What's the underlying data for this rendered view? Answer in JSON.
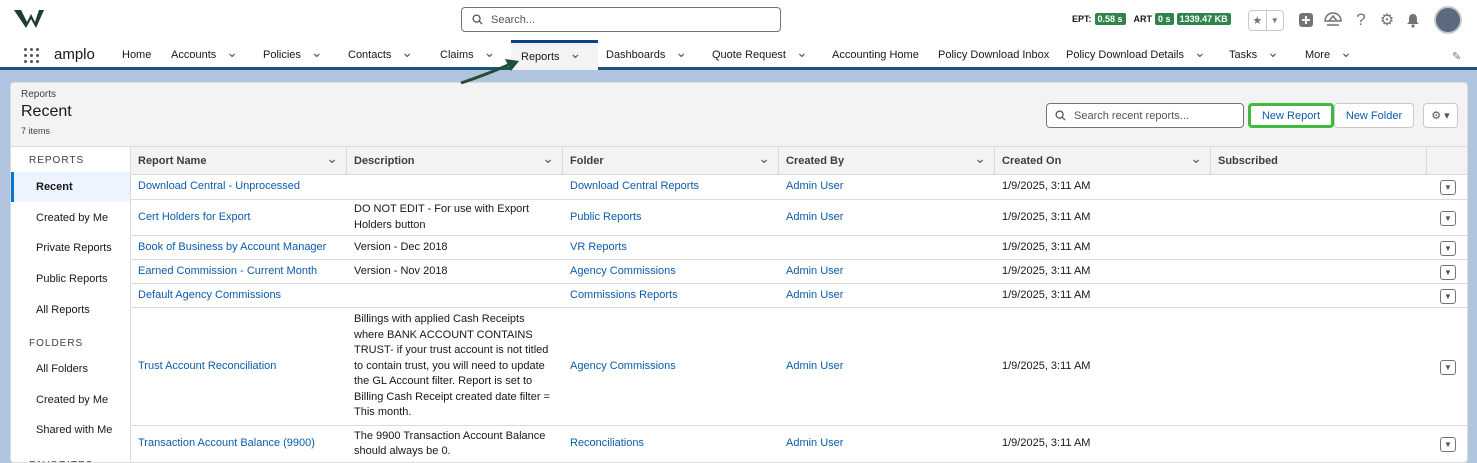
{
  "global": {
    "search_placeholder": "Search...",
    "ept_label": "EPT:",
    "ept_value": "0.58 s",
    "art_label": "ART",
    "art_value": "0 s",
    "size_value": "1339.47 KB"
  },
  "nav": {
    "app_name": "amplo",
    "items": [
      {
        "label": "Home",
        "chevron": false
      },
      {
        "label": "Accounts",
        "chevron": true
      },
      {
        "label": "Policies",
        "chevron": true
      },
      {
        "label": "Contacts",
        "chevron": true
      },
      {
        "label": "Claims",
        "chevron": true
      },
      {
        "label": "Reports",
        "chevron": true,
        "active": true
      },
      {
        "label": "Dashboards",
        "chevron": true
      },
      {
        "label": "Quote Request",
        "chevron": true
      },
      {
        "label": "Accounting Home",
        "chevron": false
      },
      {
        "label": "Policy Download Inbox",
        "chevron": false
      },
      {
        "label": "Policy Download Details",
        "chevron": true
      },
      {
        "label": "Tasks",
        "chevron": true
      },
      {
        "label": "More",
        "chevron": true
      }
    ]
  },
  "page": {
    "breadcrumb": "Reports",
    "title": "Recent",
    "count": "7 items",
    "search_placeholder": "Search recent reports...",
    "new_report": "New Report",
    "new_folder": "New Folder"
  },
  "sidebar": {
    "reports_heading": "REPORTS",
    "reports_items": [
      "Recent",
      "Created by Me",
      "Private Reports",
      "Public Reports",
      "All Reports"
    ],
    "folders_heading": "FOLDERS",
    "folders_items": [
      "All Folders",
      "Created by Me",
      "Shared with Me"
    ],
    "favorites_heading": "FAVORITES"
  },
  "table": {
    "columns": [
      "Report Name",
      "Description",
      "Folder",
      "Created By",
      "Created On",
      "Subscribed"
    ],
    "rows": [
      {
        "name": "Download Central - Unprocessed",
        "description": "",
        "folder": "Download Central Reports",
        "created_by": "Admin User",
        "created_on": "1/9/2025, 3:11 AM"
      },
      {
        "name": "Cert Holders for Export",
        "description": "DO NOT EDIT - For use with Export Holders button",
        "folder": "Public Reports",
        "created_by": "Admin User",
        "created_on": "1/9/2025, 3:11 AM"
      },
      {
        "name": "Book of Business by Account Manager",
        "description": "Version - Dec 2018",
        "folder": "VR Reports",
        "created_by": "",
        "created_on": "1/9/2025, 3:11 AM"
      },
      {
        "name": "Earned Commission - Current Month",
        "description": "Version - Nov 2018",
        "folder": "Agency Commissions",
        "created_by": "Admin User",
        "created_on": "1/9/2025, 3:11 AM"
      },
      {
        "name": "Default Agency Commissions",
        "description": "",
        "folder": "Commissions Reports",
        "created_by": "Admin User",
        "created_on": "1/9/2025, 3:11 AM"
      },
      {
        "name": "Trust Account Reconciliation",
        "description": "Billings with applied Cash Receipts where BANK ACCOUNT CONTAINS TRUST- if your trust account is not titled to contain trust, you will need to update the GL Account filter. Report is set to Billing Cash Receipt created date filter = This month.",
        "folder": "Agency Commissions",
        "created_by": "Admin User",
        "created_on": "1/9/2025, 3:11 AM"
      },
      {
        "name": "Transaction Account Balance (9900)",
        "description": "The 9900 Transaction Account Balance should always be 0.",
        "folder": "Reconciliations",
        "created_by": "Admin User",
        "created_on": "1/9/2025, 3:11 AM"
      }
    ]
  }
}
